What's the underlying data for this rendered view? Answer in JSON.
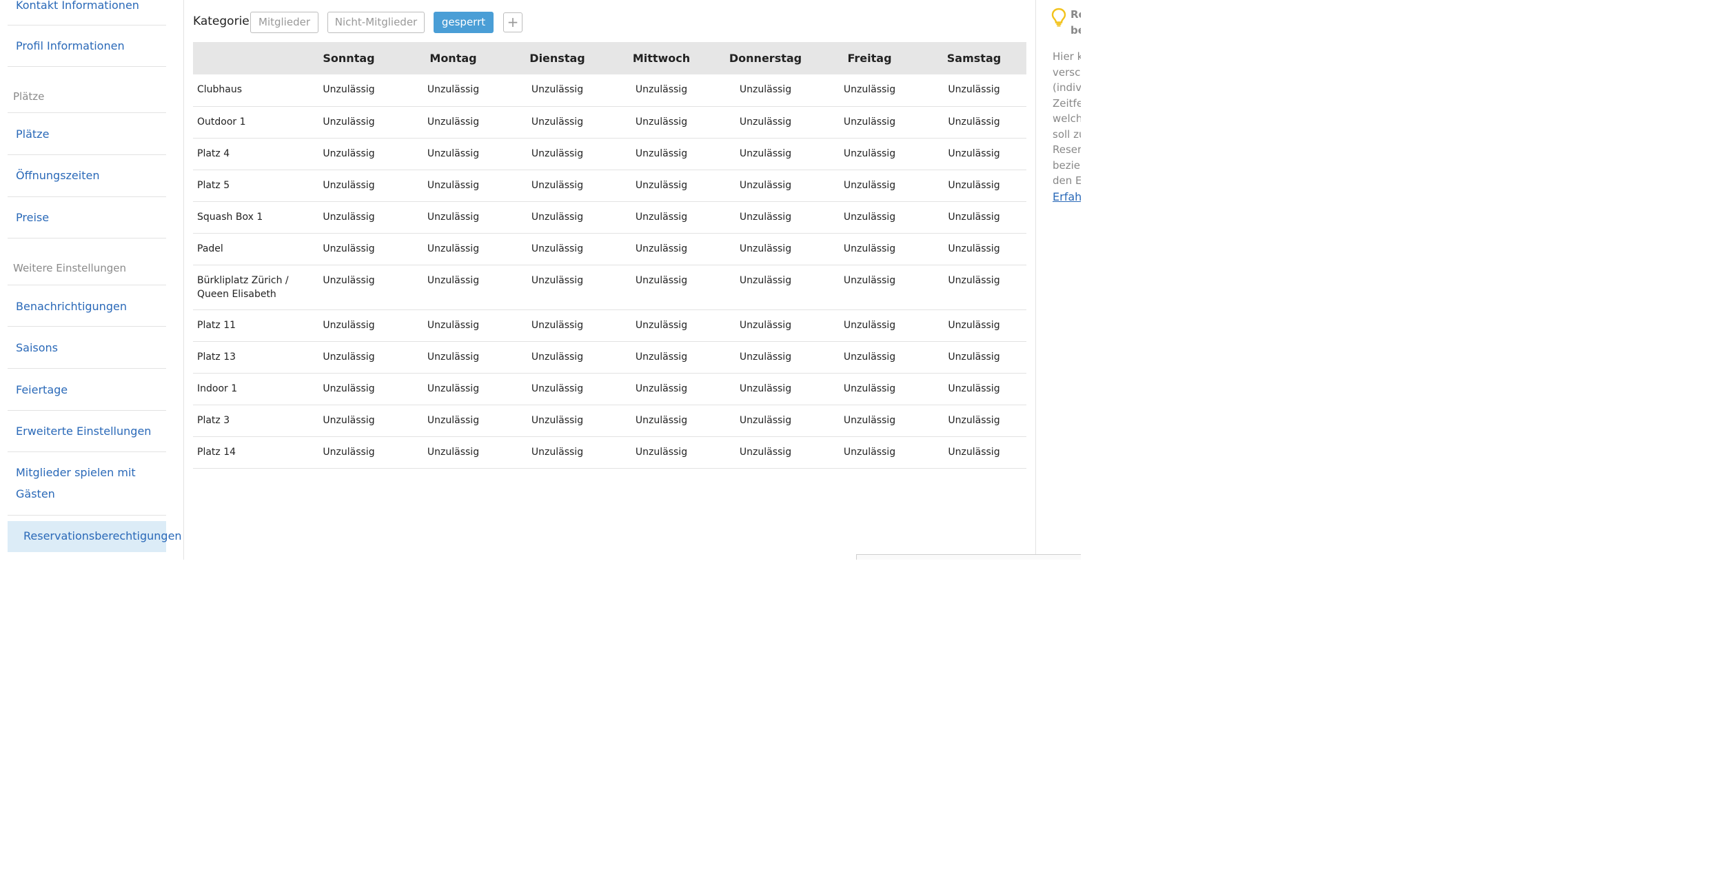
{
  "sidebar": {
    "items": [
      {
        "type": "link",
        "label": "Kontakt Informationen"
      },
      {
        "type": "link",
        "label": "Profil Informationen"
      },
      {
        "type": "section",
        "label": "Plätze"
      },
      {
        "type": "link",
        "label": "Plätze"
      },
      {
        "type": "link",
        "label": "Öffnungszeiten"
      },
      {
        "type": "link",
        "label": "Preise"
      },
      {
        "type": "section",
        "label": "Weitere Einstellungen"
      },
      {
        "type": "link",
        "label": "Benachrichtigungen"
      },
      {
        "type": "link",
        "label": "Saisons"
      },
      {
        "type": "link",
        "label": "Feiertage"
      },
      {
        "type": "link",
        "label": "Erweiterte Einstellungen"
      },
      {
        "type": "link",
        "label_line1": "Mitglieder spielen mit",
        "label_line2": "Gästen"
      },
      {
        "type": "link",
        "label": "Reservationsberechtigungen",
        "active": true
      }
    ]
  },
  "kategorie": {
    "label": "Kategorie",
    "buttons": [
      {
        "label": "Mitglieder",
        "active": false
      },
      {
        "label": "Nicht-Mitglieder",
        "active": false
      },
      {
        "label": "gesperrt",
        "active": true
      }
    ],
    "add_icon": "plus-icon"
  },
  "table": {
    "columns": [
      "",
      "Sonntag",
      "Montag",
      "Dienstag",
      "Mittwoch",
      "Donnerstag",
      "Freitag",
      "Samstag"
    ],
    "cell_value": "Unzulässig",
    "rows": [
      {
        "place": "Clubhaus",
        "values": [
          "Unzulässig",
          "Unzulässig",
          "Unzulässig",
          "Unzulässig",
          "Unzulässig",
          "Unzulässig",
          "Unzulässig"
        ]
      },
      {
        "place": "Outdoor 1",
        "values": [
          "Unzulässig",
          "Unzulässig",
          "Unzulässig",
          "Unzulässig",
          "Unzulässig",
          "Unzulässig",
          "Unzulässig"
        ]
      },
      {
        "place": "Platz 4",
        "values": [
          "Unzulässig",
          "Unzulässig",
          "Unzulässig",
          "Unzulässig",
          "Unzulässig",
          "Unzulässig",
          "Unzulässig"
        ]
      },
      {
        "place": "Platz 5",
        "values": [
          "Unzulässig",
          "Unzulässig",
          "Unzulässig",
          "Unzulässig",
          "Unzulässig",
          "Unzulässig",
          "Unzulässig"
        ]
      },
      {
        "place": "Squash Box 1",
        "values": [
          "Unzulässig",
          "Unzulässig",
          "Unzulässig",
          "Unzulässig",
          "Unzulässig",
          "Unzulässig",
          "Unzulässig"
        ]
      },
      {
        "place": "Padel",
        "values": [
          "Unzulässig",
          "Unzulässig",
          "Unzulässig",
          "Unzulässig",
          "Unzulässig",
          "Unzulässig",
          "Unzulässig"
        ]
      },
      {
        "place": "Bürkliplatz Zürich / Queen Elisabeth",
        "values": [
          "Unzulässig",
          "Unzulässig",
          "Unzulässig",
          "Unzulässig",
          "Unzulässig",
          "Unzulässig",
          "Unzulässig"
        ]
      },
      {
        "place": "Platz 11",
        "values": [
          "Unzulässig",
          "Unzulässig",
          "Unzulässig",
          "Unzulässig",
          "Unzulässig",
          "Unzulässig",
          "Unzulässig"
        ]
      },
      {
        "place": "Platz 13",
        "values": [
          "Unzulässig",
          "Unzulässig",
          "Unzulässig",
          "Unzulässig",
          "Unzulässig",
          "Unzulässig",
          "Unzulässig"
        ]
      },
      {
        "place": "Indoor 1",
        "values": [
          "Unzulässig",
          "Unzulässig",
          "Unzulässig",
          "Unzulässig",
          "Unzulässig",
          "Unzulässig",
          "Unzulässig"
        ]
      },
      {
        "place": "Platz 3",
        "values": [
          "Unzulässig",
          "Unzulässig",
          "Unzulässig",
          "Unzulässig",
          "Unzulässig",
          "Unzulässig",
          "Unzulässig"
        ]
      },
      {
        "place": "Platz 14",
        "values": [
          "Unzulässig",
          "Unzulässig",
          "Unzulässig",
          "Unzulässig",
          "Unzulässig",
          "Unzulässig",
          "Unzulässig"
        ]
      }
    ]
  },
  "right_panel": {
    "icon": "lightbulb-icon",
    "accent_color": "#f2c21b",
    "title_line1": "Re",
    "title_line2": "be",
    "text_lines": [
      "Hier k",
      "versch",
      "(indiv",
      "Zeitfe",
      "welch",
      "soll zu",
      "Reser",
      "bezie",
      "den E"
    ],
    "link": "Erfah"
  }
}
